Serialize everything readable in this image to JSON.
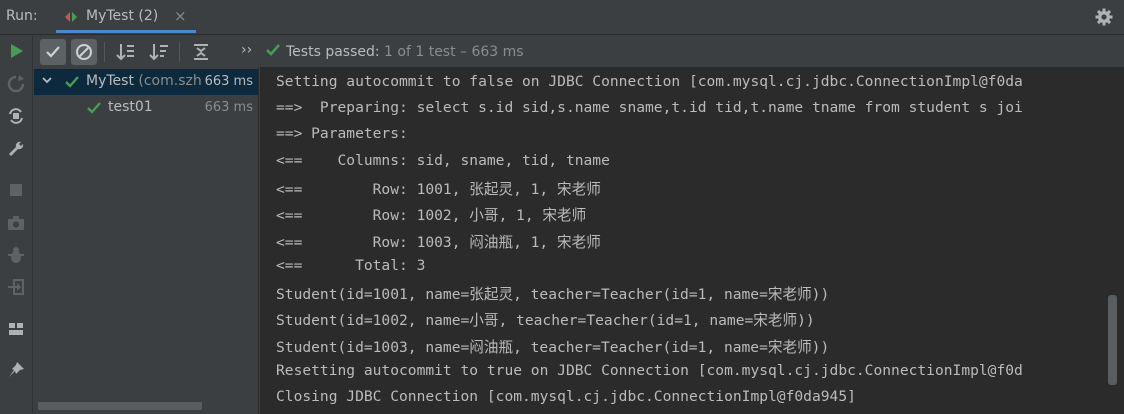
{
  "runbar": {
    "label": "Run:",
    "tab_title": "MyTest (2)",
    "close_glyph": "×",
    "icons": [
      "run-config-icon",
      "close-icon",
      "gear-icon"
    ]
  },
  "test_toolbar": {
    "buttons": [
      "show-passed-icon",
      "show-ignored-icon",
      "sort-alpha-icon",
      "sort-duration-icon",
      "collapse-all-icon",
      "more-chevron-icon"
    ],
    "more_glyph": "››",
    "status_lead": "Tests passed:",
    "status_rest": " 1 of 1 test – 663 ms"
  },
  "tree": {
    "root": {
      "name": "MyTest",
      "package": " (com.szh",
      "time": "663 ms"
    },
    "child": {
      "name": "test01",
      "time": "663 ms"
    }
  },
  "console": {
    "lines": [
      "Setting autocommit to false on JDBC Connection [com.mysql.cj.jdbc.ConnectionImpl@f0da",
      "==>  Preparing: select s.id sid,s.name sname,t.id tid,t.name tname from student s joi",
      "==> Parameters: ",
      "<==    Columns: sid, sname, tid, tname",
      "<==        Row: 1001, 张起灵, 1, 宋老师",
      "<==        Row: 1002, 小哥, 1, 宋老师",
      "<==        Row: 1003, 闷油瓶, 1, 宋老师",
      "<==      Total: 3",
      "Student(id=1001, name=张起灵, teacher=Teacher(id=1, name=宋老师))",
      "Student(id=1002, name=小哥, teacher=Teacher(id=1, name=宋老师))",
      "Student(id=1003, name=闷油瓶, teacher=Teacher(id=1, name=宋老师))",
      "Resetting autocommit to true on JDBC Connection [com.mysql.cj.jdbc.ConnectionImpl@f0d",
      "Closing JDBC Connection [com.mysql.cj.jdbc.ConnectionImpl@f0da945]"
    ]
  },
  "colors": {
    "accent_tab": "#4a88c7",
    "pass_green": "#499c54",
    "run_green": "#499c54",
    "selection": "#0d293e",
    "console_bg": "#2b2b2b",
    "panel_bg": "#3c3f41"
  }
}
